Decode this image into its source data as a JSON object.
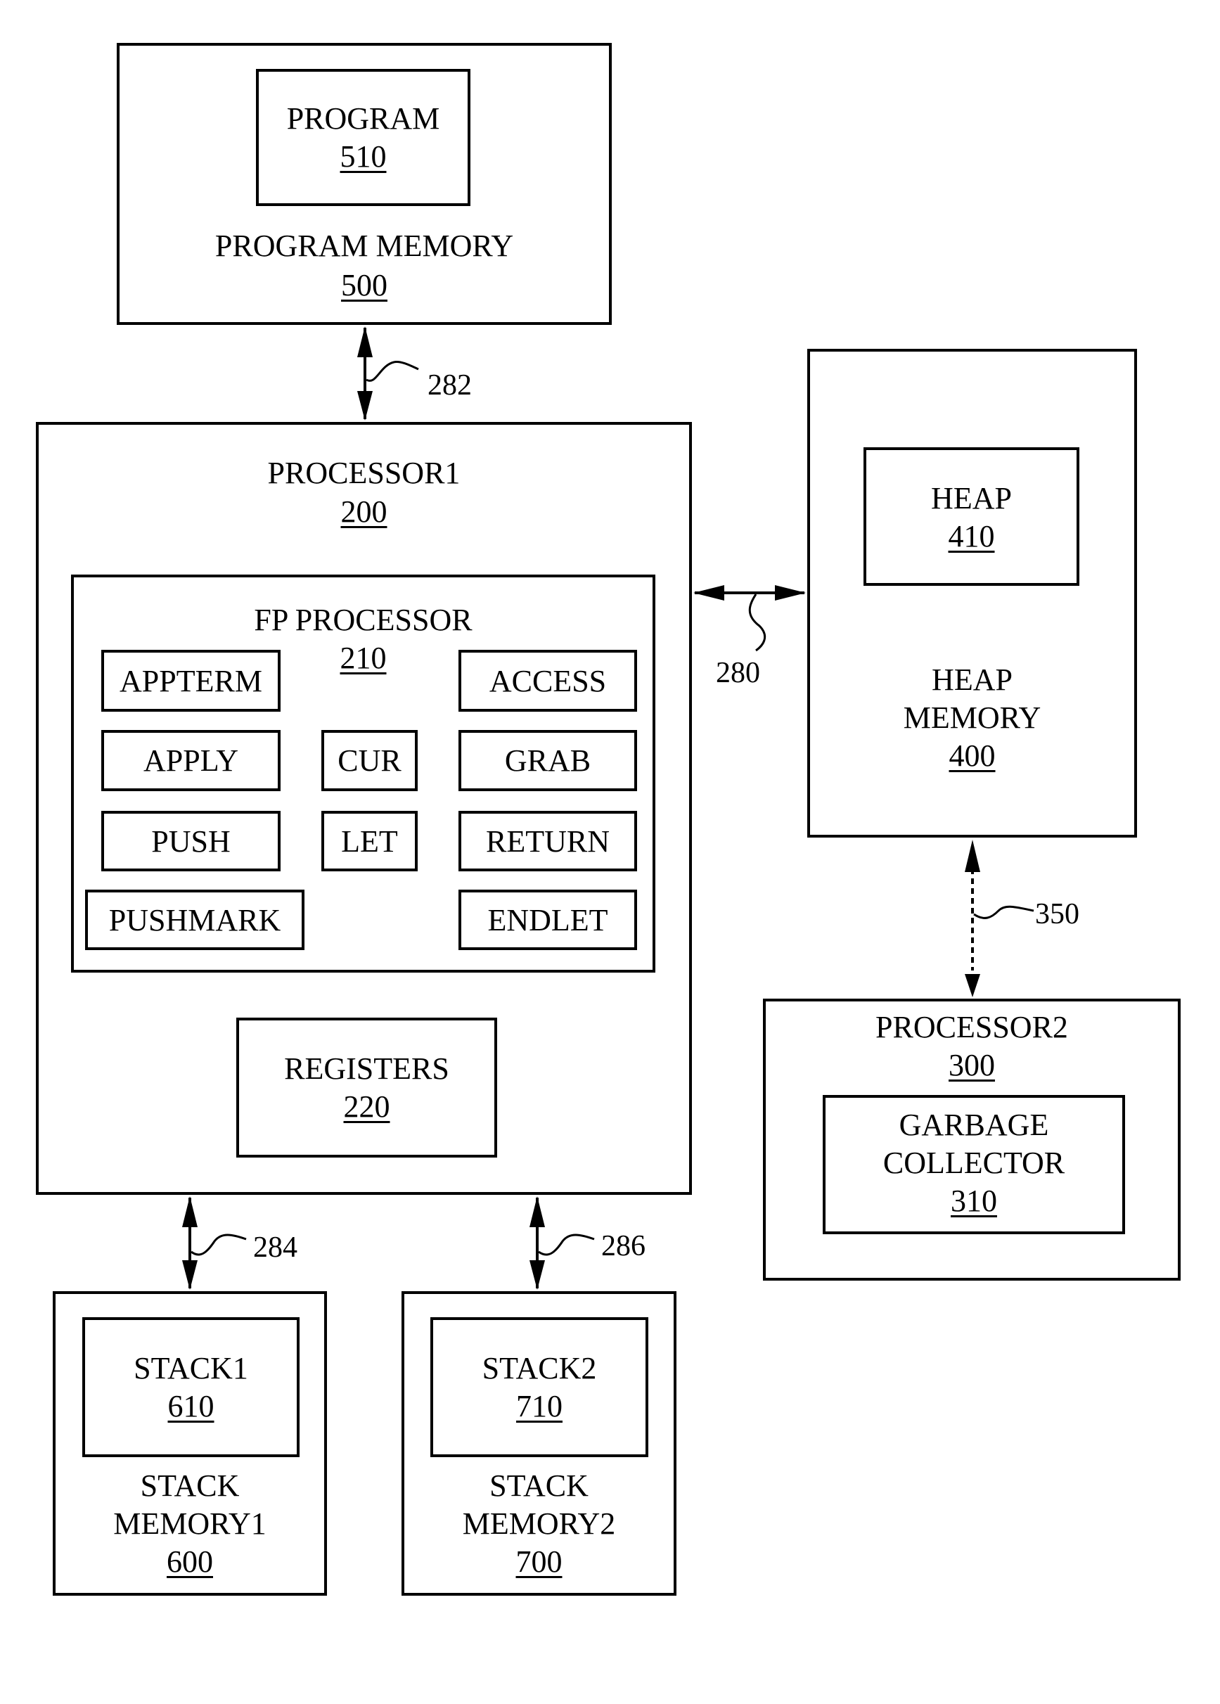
{
  "program_memory": {
    "name": "PROGRAM MEMORY",
    "ref": "500",
    "program": {
      "name": "PROGRAM",
      "ref": "510"
    }
  },
  "processor1": {
    "name": "PROCESSOR1",
    "ref": "200",
    "fp_processor": {
      "name": "FP PROCESSOR",
      "ref": "210",
      "instructions": [
        "APPTERM",
        "ACCESS",
        "APPLY",
        "CUR",
        "GRAB",
        "PUSH",
        "LET",
        "RETURN",
        "PUSHMARK",
        "ENDLET"
      ]
    },
    "registers": {
      "name": "REGISTERS",
      "ref": "220"
    }
  },
  "heap_memory": {
    "name_line1": "HEAP",
    "name_line2": "MEMORY",
    "ref": "400",
    "heap": {
      "name": "HEAP",
      "ref": "410"
    }
  },
  "processor2": {
    "name": "PROCESSOR2",
    "ref": "300",
    "garbage_collector": {
      "name_line1": "GARBAGE",
      "name_line2": "COLLECTOR",
      "ref": "310"
    }
  },
  "stack_memory1": {
    "name_line1": "STACK",
    "name_line2": "MEMORY1",
    "ref": "600",
    "stack": {
      "name": "STACK1",
      "ref": "610"
    }
  },
  "stack_memory2": {
    "name_line1": "STACK",
    "name_line2": "MEMORY2",
    "ref": "700",
    "stack": {
      "name": "STACK2",
      "ref": "710"
    }
  },
  "connections": {
    "c282": {
      "label": "282",
      "from": "PROGRAM MEMORY 500",
      "to": "PROCESSOR1 200",
      "style": "solid"
    },
    "c280": {
      "label": "280",
      "from": "PROCESSOR1 200",
      "to": "HEAP MEMORY 400",
      "style": "solid"
    },
    "c350": {
      "label": "350",
      "from": "HEAP MEMORY 400",
      "to": "PROCESSOR2 300",
      "style": "dashed"
    },
    "c284": {
      "label": "284",
      "from": "PROCESSOR1 200",
      "to": "STACK MEMORY1 600",
      "style": "solid"
    },
    "c286": {
      "label": "286",
      "from": "PROCESSOR1 200",
      "to": "STACK MEMORY2 700",
      "style": "solid"
    }
  }
}
